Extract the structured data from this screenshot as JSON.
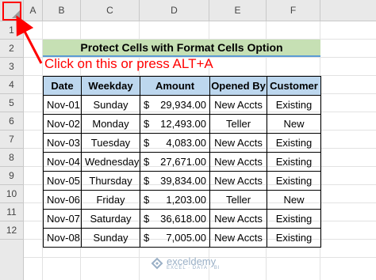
{
  "sheet": {
    "columns": [
      "A",
      "B",
      "C",
      "D",
      "E",
      "F"
    ],
    "rows": [
      "1",
      "2",
      "3",
      "4",
      "5",
      "6",
      "7",
      "8",
      "9",
      "10",
      "11",
      "12"
    ]
  },
  "title": "Protect Cells with Format Cells Option",
  "annotation": "Click on this or press ALT+A",
  "table": {
    "headers": [
      "Date",
      "Weekday",
      "Amount",
      "Opened By",
      "Customer"
    ],
    "rows": [
      {
        "date": "Nov-01",
        "weekday": "Sunday",
        "currency": "$",
        "amount": "29,934.00",
        "opened_by": "New Accts",
        "customer": "Existing"
      },
      {
        "date": "Nov-02",
        "weekday": "Monday",
        "currency": "$",
        "amount": "12,493.00",
        "opened_by": "Teller",
        "customer": "New"
      },
      {
        "date": "Nov-03",
        "weekday": "Tuesday",
        "currency": "$",
        "amount": "4,083.00",
        "opened_by": "New Accts",
        "customer": "Existing"
      },
      {
        "date": "Nov-04",
        "weekday": "Wednesday",
        "currency": "$",
        "amount": "27,671.00",
        "opened_by": "New Accts",
        "customer": "Existing"
      },
      {
        "date": "Nov-05",
        "weekday": "Thursday",
        "currency": "$",
        "amount": "39,834.00",
        "opened_by": "New Accts",
        "customer": "Existing"
      },
      {
        "date": "Nov-06",
        "weekday": "Friday",
        "currency": "$",
        "amount": "1,203.00",
        "opened_by": "Teller",
        "customer": "New"
      },
      {
        "date": "Nov-07",
        "weekday": "Saturday",
        "currency": "$",
        "amount": "36,618.00",
        "opened_by": "New Accts",
        "customer": "Existing"
      },
      {
        "date": "Nov-08",
        "weekday": "Sunday",
        "currency": "$",
        "amount": "7,005.00",
        "opened_by": "New Accts",
        "customer": "Existing"
      }
    ]
  },
  "watermark": {
    "name": "exceldemy",
    "tagline": "EXCEL · DATA · BI"
  },
  "colors": {
    "arrow": "#ff0000",
    "title_fill": "#c6e0b4",
    "header_fill": "#bdd7ee",
    "annotation": "#ff0000"
  }
}
